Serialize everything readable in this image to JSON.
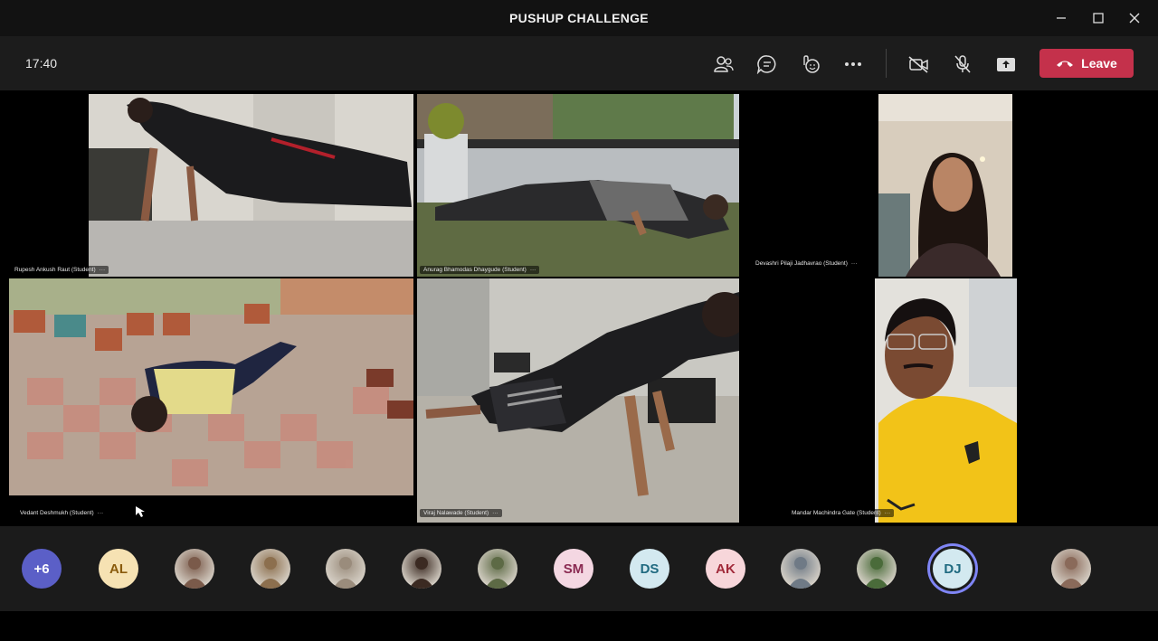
{
  "window": {
    "title": "PUSHUP CHALLENGE"
  },
  "toolbar": {
    "timer": "17:40",
    "leave_label": "Leave",
    "icons": [
      "people-icon",
      "chat-icon",
      "reactions-icon",
      "more-icon",
      "camera-off-icon",
      "mic-off-icon",
      "share-icon",
      "phone-hangup-icon"
    ]
  },
  "tiles": [
    {
      "name": "Rupesh Ankush Raut (Student)"
    },
    {
      "name": "Anurag Bhamodas Dhaygude (Student)"
    },
    {
      "name": "Devashri Pilaji Jadhavrao (Student)"
    },
    {
      "name": "Vedant Deshmukh (Student)"
    },
    {
      "name": "Viraj Nalawade (Student)"
    },
    {
      "name": "Mandar Machindra Gate (Student)"
    }
  ],
  "tile_more": "···",
  "avatars": [
    {
      "text": "+6",
      "bg": "#5b5fc7",
      "fg": "#ffffff"
    },
    {
      "text": "AL",
      "bg": "#f6e2b3",
      "fg": "#8a5b0c"
    },
    {
      "text": "",
      "photo": "#7a5a4a"
    },
    {
      "text": "",
      "photo": "#8c6f4e"
    },
    {
      "text": "",
      "photo": "#9a8c7c"
    },
    {
      "text": "",
      "photo": "#3b2a22"
    },
    {
      "text": "",
      "photo": "#5d6a45"
    },
    {
      "text": "SM",
      "bg": "#f4d7e2",
      "fg": "#8a2a52"
    },
    {
      "text": "DS",
      "bg": "#d3e9f0",
      "fg": "#1f6a80"
    },
    {
      "text": "AK",
      "bg": "#f7d6da",
      "fg": "#a12a3a"
    },
    {
      "text": "",
      "photo": "#6f7a86"
    },
    {
      "text": "",
      "photo": "#4a6b3a"
    },
    {
      "text": "DJ",
      "bg": "#d3e9f0",
      "fg": "#1f6a80",
      "active": true
    },
    {
      "text": "",
      "photo": "#8a6a5a"
    }
  ],
  "colors": {
    "leave": "#c4314b",
    "active_ring": "#7f85f5",
    "titlebar": "#121212",
    "toolbar": "#1c1c1c"
  }
}
